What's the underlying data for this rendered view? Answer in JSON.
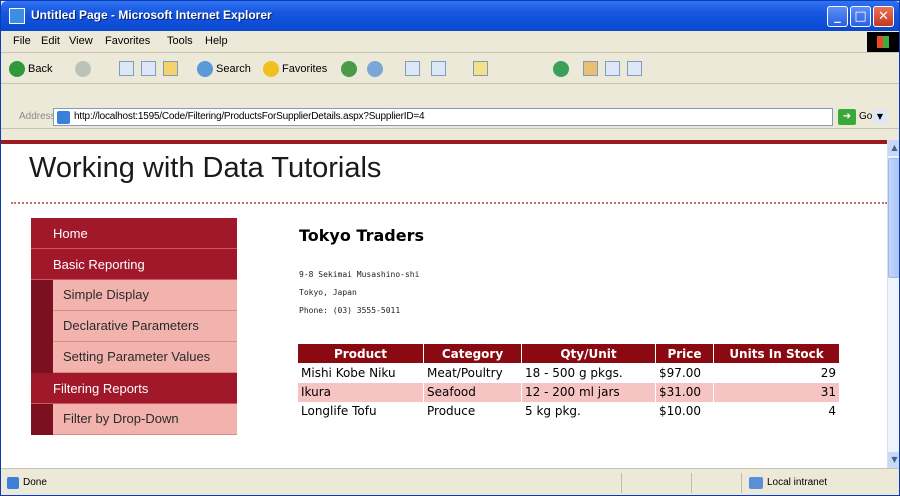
{
  "window": {
    "title": "Untitled Page - Microsoft Internet Explorer",
    "min_glyph": "_",
    "max_glyph": "□",
    "close_glyph": "✕"
  },
  "menu": [
    "File",
    "Edit",
    "View",
    "Favorites",
    "Tools",
    "Help"
  ],
  "toolbar": {
    "back_label": "Back",
    "search_label": "Search",
    "favorites_label": "Favorites"
  },
  "address": {
    "label": "Address",
    "url": "http://localhost:1595/Code/Filtering/ProductsForSupplierDetails.aspx?SupplierID=4",
    "go_label": "Go"
  },
  "page": {
    "site_title": "Working with Data Tutorials",
    "nav": {
      "home": "Home",
      "basic_reporting": "Basic Reporting",
      "simple_display": "Simple Display",
      "declarative_parameters": "Declarative Parameters",
      "setting_parameter_values": "Setting Parameter Values",
      "filtering_reports": "Filtering Reports",
      "filter_by_dropdown": "Filter by Drop-Down"
    },
    "supplier": {
      "name": "Tokyo Traders",
      "address": "9-8 Sekimai Musashino-shi",
      "city_country": "Tokyo, Japan",
      "phone": "Phone: (03) 3555-5011"
    },
    "products_table": {
      "headers": [
        "Product",
        "Category",
        "Qty/Unit",
        "Price",
        "Units In Stock"
      ],
      "rows": [
        [
          "Mishi Kobe Niku",
          "Meat/Poultry",
          "18 - 500 g pkgs.",
          "$97.00",
          "29"
        ],
        [
          "Ikura",
          "Seafood",
          "12 - 200 ml jars",
          "$31.00",
          "31"
        ],
        [
          "Longlife Tofu",
          "Produce",
          "5 kg pkg.",
          "$10.00",
          "4"
        ]
      ]
    }
  },
  "status": {
    "text": "Done",
    "zone": "Local intranet"
  }
}
